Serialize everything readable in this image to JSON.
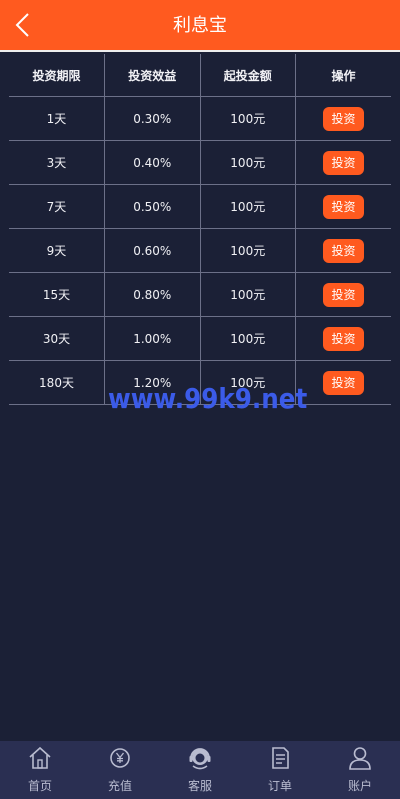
{
  "header": {
    "title": "利息宝"
  },
  "table": {
    "columns": [
      "投资期限",
      "投资效益",
      "起投金额",
      "操作"
    ],
    "rows": [
      {
        "term": "1天",
        "yield": "0.30%",
        "min": "100元",
        "action": "投资"
      },
      {
        "term": "3天",
        "yield": "0.40%",
        "min": "100元",
        "action": "投资"
      },
      {
        "term": "7天",
        "yield": "0.50%",
        "min": "100元",
        "action": "投资"
      },
      {
        "term": "9天",
        "yield": "0.60%",
        "min": "100元",
        "action": "投资"
      },
      {
        "term": "15天",
        "yield": "0.80%",
        "min": "100元",
        "action": "投资"
      },
      {
        "term": "30天",
        "yield": "1.00%",
        "min": "100元",
        "action": "投资"
      },
      {
        "term": "180天",
        "yield": "1.20%",
        "min": "100元",
        "action": "投资"
      }
    ]
  },
  "watermark": "www.99k9.net",
  "tabbar": {
    "items": [
      {
        "label": "首页",
        "icon": "home-icon"
      },
      {
        "label": "充值",
        "icon": "yen-coin-icon"
      },
      {
        "label": "客服",
        "icon": "headset-icon"
      },
      {
        "label": "订单",
        "icon": "document-icon"
      },
      {
        "label": "账户",
        "icon": "user-icon"
      }
    ]
  },
  "colors": {
    "accent": "#ff5a1f",
    "background": "#1b2036",
    "tabbar": "#2a2f52",
    "watermark": "#3b5be8"
  }
}
